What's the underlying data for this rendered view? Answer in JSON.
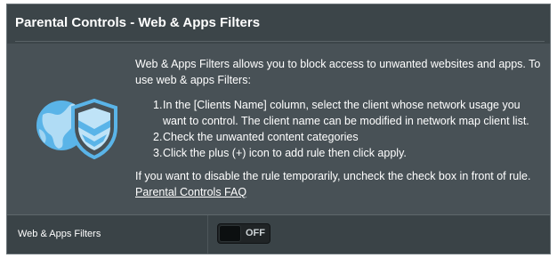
{
  "header": {
    "title": "Parental Controls - Web & Apps Filters"
  },
  "description": {
    "intro": "Web & Apps Filters allows you to block access to unwanted websites and apps. To use web & apps Filters:",
    "steps": [
      {
        "num": "1.",
        "text": "In the [Clients Name] column, select the client whose network usage you want to control. The client name can be modified in network map client list."
      },
      {
        "num": "2.",
        "text": "Check the unwanted content categories"
      },
      {
        "num": "3.",
        "text": "Click the plus (+) icon to add rule then click apply."
      }
    ],
    "note": "If you want to disable the rule temporarily, uncheck the check box in front of rule.",
    "faq_link": "Parental Controls FAQ"
  },
  "filter_row": {
    "label": "Web & Apps Filters",
    "toggle_state": "OFF"
  },
  "logo": {
    "icon": "globe-shield-icon",
    "colors": {
      "primary": "#5ab4e8",
      "light": "#bfe3f7"
    }
  }
}
